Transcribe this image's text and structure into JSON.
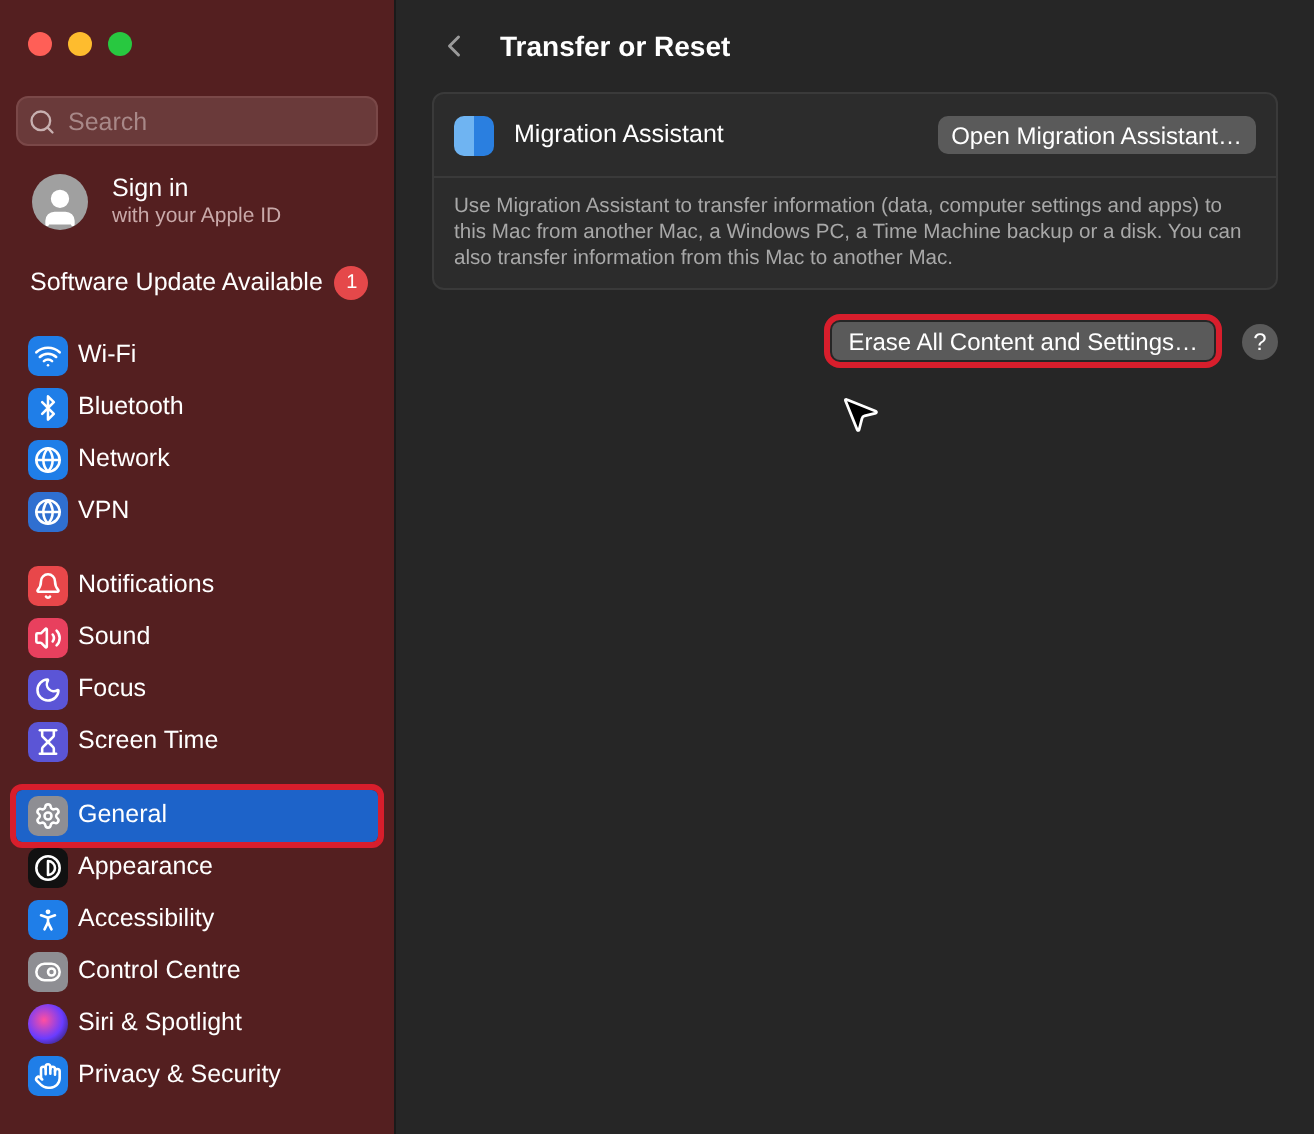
{
  "search": {
    "placeholder": "Search"
  },
  "account": {
    "title": "Sign in",
    "subtitle": "with your Apple ID"
  },
  "update": {
    "label": "Software Update Available",
    "badge": "1"
  },
  "sidebar": {
    "groups": [
      {
        "items": [
          {
            "label": "Wi-Fi",
            "kind": "wifi",
            "selected": false,
            "highlighted": false
          },
          {
            "label": "Bluetooth",
            "kind": "bluetooth",
            "selected": false,
            "highlighted": false
          },
          {
            "label": "Network",
            "kind": "network",
            "selected": false,
            "highlighted": false
          },
          {
            "label": "VPN",
            "kind": "vpn",
            "selected": false,
            "highlighted": false
          }
        ]
      },
      {
        "items": [
          {
            "label": "Notifications",
            "kind": "notifications",
            "selected": false,
            "highlighted": false
          },
          {
            "label": "Sound",
            "kind": "sound",
            "selected": false,
            "highlighted": false
          },
          {
            "label": "Focus",
            "kind": "focus",
            "selected": false,
            "highlighted": false
          },
          {
            "label": "Screen Time",
            "kind": "screentime",
            "selected": false,
            "highlighted": false
          }
        ]
      },
      {
        "items": [
          {
            "label": "General",
            "kind": "general",
            "selected": true,
            "highlighted": true
          },
          {
            "label": "Appearance",
            "kind": "appearance",
            "selected": false,
            "highlighted": false
          },
          {
            "label": "Accessibility",
            "kind": "accessibility",
            "selected": false,
            "highlighted": false
          },
          {
            "label": "Control Centre",
            "kind": "controlcentre",
            "selected": false,
            "highlighted": false
          },
          {
            "label": "Siri & Spotlight",
            "kind": "siri",
            "selected": false,
            "highlighted": false
          },
          {
            "label": "Privacy & Security",
            "kind": "privacy",
            "selected": false,
            "highlighted": false
          }
        ]
      }
    ]
  },
  "page": {
    "title": "Transfer or Reset",
    "migration": {
      "title": "Migration Assistant",
      "button": "Open Migration Assistant…",
      "description": "Use Migration Assistant to transfer information (data, computer settings and apps) to this Mac from another Mac, a Windows PC, a Time Machine backup or a disk. You can also transfer information from this Mac to another Mac."
    },
    "erase_button": {
      "label": "Erase All Content and Settings…",
      "highlighted": true
    },
    "help": "?"
  }
}
